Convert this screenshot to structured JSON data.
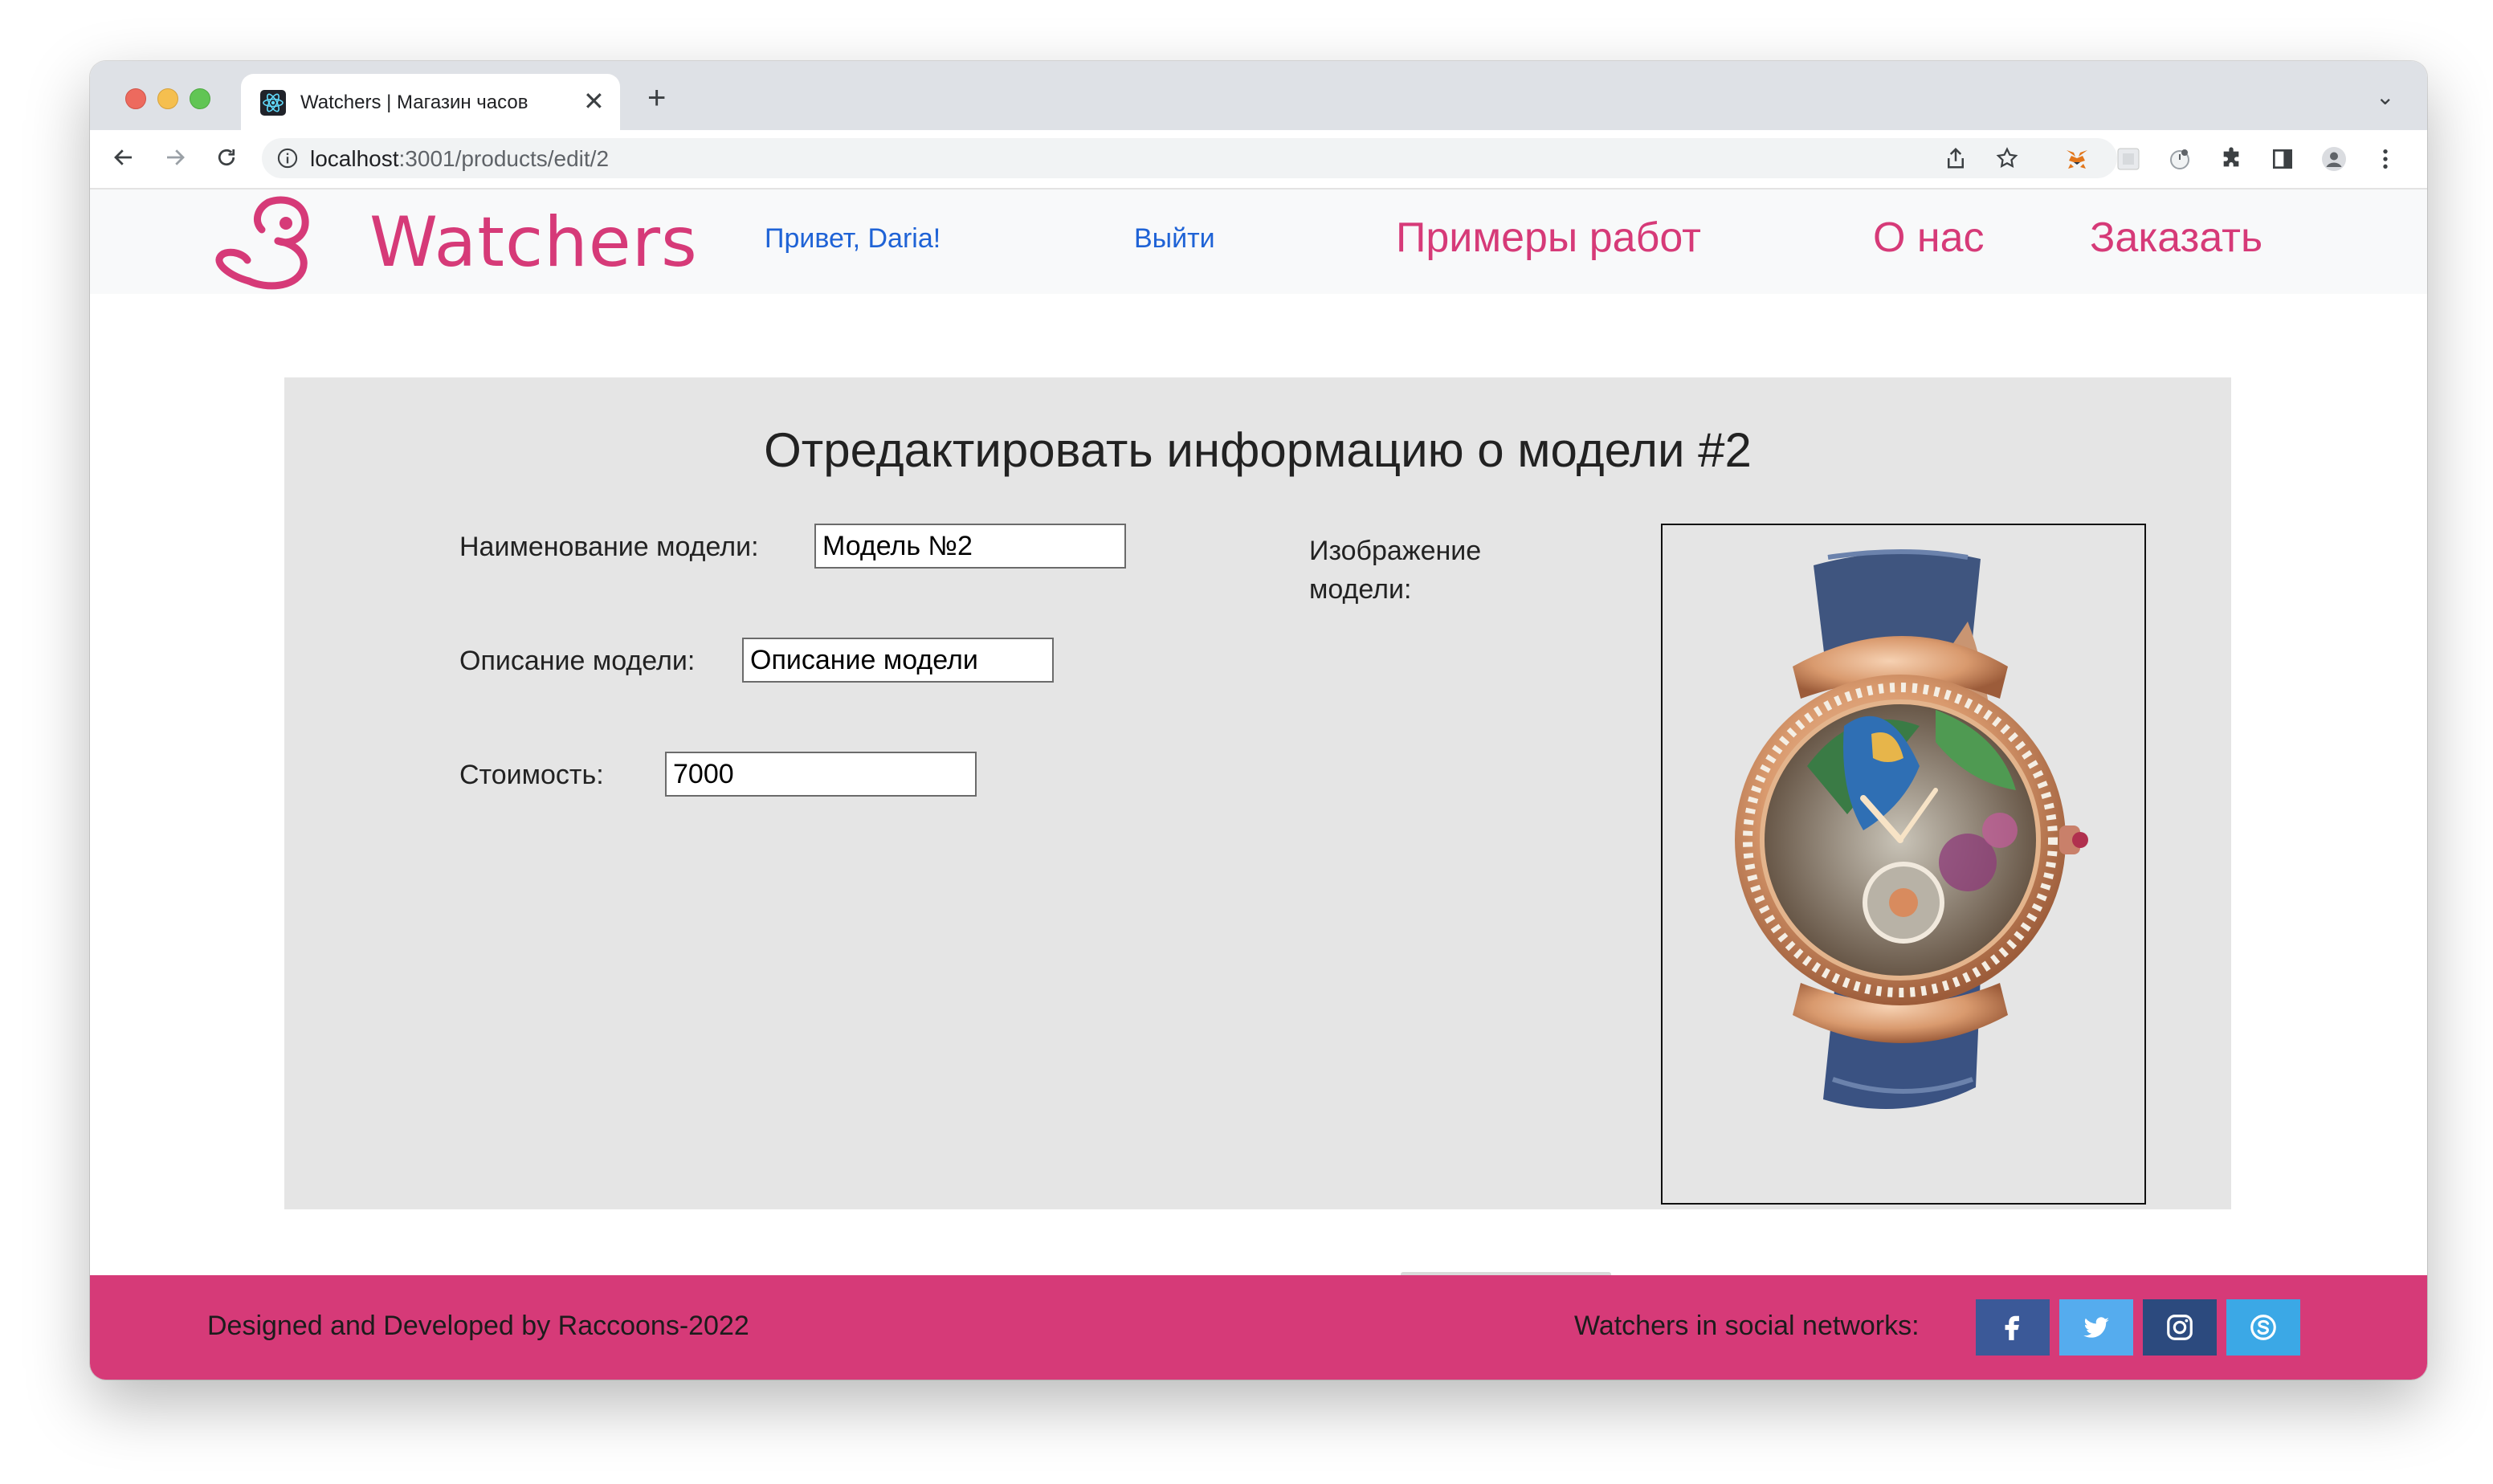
{
  "browser": {
    "tab_title": "Watchers | Магазин часов",
    "url_host": "localhost",
    "url_path": ":3001/products/edit/2"
  },
  "site": {
    "brand": "Watchers",
    "greeting": "Привет, Daria!",
    "logout": "Выйти",
    "menu": [
      "Примеры работ",
      "О нас",
      "Заказать"
    ]
  },
  "form": {
    "title": "Отредактировать информацию о модели #2",
    "name_label": "Наименование модели:",
    "name_value": "Модель №2",
    "desc_label": "Описание модели:",
    "desc_value": "Описание модели",
    "price_label": "Стоимость:",
    "price_value": "7000",
    "image_label": "Изображение модели:"
  },
  "footer": {
    "credit": "Designed and Developed by Raccoons-2022",
    "social_label": "Watchers in social networks:",
    "social": [
      {
        "icon": "facebook-icon",
        "color": "#3b5998"
      },
      {
        "icon": "twitter-icon",
        "color": "#55acee"
      },
      {
        "icon": "instagram-icon",
        "color": "#2c4a7e"
      },
      {
        "icon": "skype-icon",
        "color": "#3ba8e6"
      }
    ]
  },
  "colors": {
    "accent": "#d63a78",
    "link": "#1f63d6",
    "card_bg": "#e5e5e5"
  }
}
